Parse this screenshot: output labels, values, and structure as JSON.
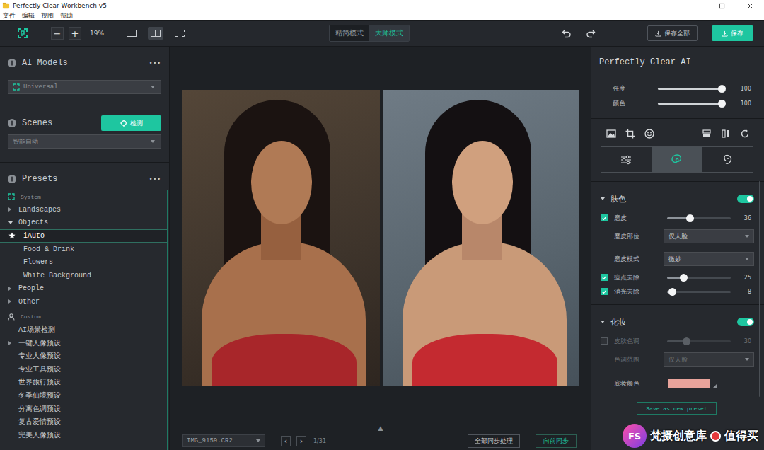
{
  "window": {
    "title": "Perfectly Clear Workbench v5"
  },
  "menu": [
    "文件",
    "编辑",
    "视图",
    "帮助"
  ],
  "toolbar": {
    "zoom_out": "−",
    "zoom_in": "+",
    "zoom": "19%",
    "views": [
      {
        "kind": "single",
        "selected": false
      },
      {
        "kind": "split",
        "selected": true
      },
      {
        "kind": "crop",
        "selected": false
      }
    ],
    "modes": [
      {
        "label": "精简模式",
        "selected": false
      },
      {
        "label": "大师模式",
        "selected": true
      }
    ],
    "save_all": "保存全部",
    "save": "保存"
  },
  "left": {
    "ai_models": {
      "title": "AI Models",
      "more": "•••",
      "value": "Universal"
    },
    "scenes": {
      "title": "Scenes",
      "detect": "检测",
      "value": "智能自动"
    },
    "presets": {
      "title": "Presets",
      "more": "•••",
      "groups": [
        {
          "label": "System",
          "kind": "system",
          "items": [
            {
              "label": "Landscapes",
              "kind": "folder",
              "expanded": false,
              "selected": false,
              "children": []
            },
            {
              "label": "Objects",
              "kind": "folder",
              "expanded": true,
              "selected": false,
              "children": [
                {
                  "label": "iAuto",
                  "starred": true,
                  "selected": true
                },
                {
                  "label": "Food & Drink",
                  "starred": false,
                  "selected": false
                },
                {
                  "label": "Flowers",
                  "starred": false,
                  "selected": false
                },
                {
                  "label": "White Background",
                  "starred": false,
                  "selected": false
                }
              ]
            },
            {
              "label": "People",
              "kind": "folder",
              "expanded": false,
              "selected": false,
              "children": []
            },
            {
              "label": "Other",
              "kind": "folder",
              "expanded": false,
              "selected": false,
              "children": []
            }
          ]
        },
        {
          "label": "Custom",
          "kind": "custom",
          "items": [
            {
              "label": "AI场景检测",
              "kind": "item",
              "selected": false
            },
            {
              "label": "一键人像预设",
              "kind": "folder",
              "expanded": false,
              "selected": false,
              "children": []
            },
            {
              "label": "专业人像预设",
              "kind": "item",
              "selected": false
            },
            {
              "label": "专业工具预设",
              "kind": "item",
              "selected": false
            },
            {
              "label": "世界旅行预设",
              "kind": "item",
              "selected": false
            },
            {
              "label": "冬季仙境预设",
              "kind": "item",
              "selected": false
            },
            {
              "label": "分离色调预设",
              "kind": "item",
              "selected": false
            },
            {
              "label": "复古爱情预设",
              "kind": "item",
              "selected": false
            },
            {
              "label": "完美人像预设",
              "kind": "item",
              "selected": false
            }
          ]
        }
      ]
    }
  },
  "center": {
    "photos": [
      {
        "kind": "before"
      },
      {
        "kind": "after"
      }
    ],
    "collapse": "▲",
    "file": "IMG_9159.CR2",
    "prev": "‹",
    "next": "›",
    "page": "1/31",
    "sync_all": "全部同步处理",
    "sync_forward": "向前同步"
  },
  "right": {
    "title": "Perfectly Clear AI",
    "master": [
      {
        "label": "强度",
        "level": 1,
        "reading": "100"
      },
      {
        "label": "颜色",
        "level": 1,
        "reading": "100"
      }
    ],
    "tabs": [
      {
        "kind": "adjust",
        "selected": false
      },
      {
        "kind": "ai",
        "selected": true
      },
      {
        "kind": "retouch",
        "selected": false
      }
    ],
    "sections": [
      {
        "title": "肤色",
        "expanded": true,
        "on": true,
        "rows": [
          {
            "kind": "slider",
            "label": "磨皮",
            "checked": true,
            "disabled": false,
            "level": 0.36,
            "reading": "36"
          },
          {
            "kind": "dropdown",
            "label": "磨皮部位",
            "value": "仅人脸",
            "disabled": false
          },
          {
            "kind": "dropdown",
            "label": "磨皮模式",
            "value": "微妙",
            "disabled": false
          },
          {
            "kind": "slider",
            "label": "痘点去除",
            "checked": true,
            "disabled": false,
            "level": 0.25,
            "reading": "25"
          },
          {
            "kind": "slider",
            "label": "消光去除",
            "checked": true,
            "disabled": false,
            "level": 0.08,
            "reading": "8"
          }
        ]
      },
      {
        "title": "化妆",
        "expanded": true,
        "on": true,
        "rows": [
          {
            "kind": "slider",
            "label": "皮肤色调",
            "checked": false,
            "disabled": true,
            "level": 0.3,
            "reading": "30"
          },
          {
            "kind": "dropdown",
            "label": "色调范围",
            "value": "仅人脸",
            "disabled": true
          },
          {
            "kind": "color",
            "label": "底妆颜色",
            "color": "#e8a39b"
          }
        ]
      }
    ],
    "save_preset": "Save as new preset"
  },
  "watermark": {
    "logo": "FS",
    "text": "梵摄创意库",
    "site": "值得买"
  }
}
